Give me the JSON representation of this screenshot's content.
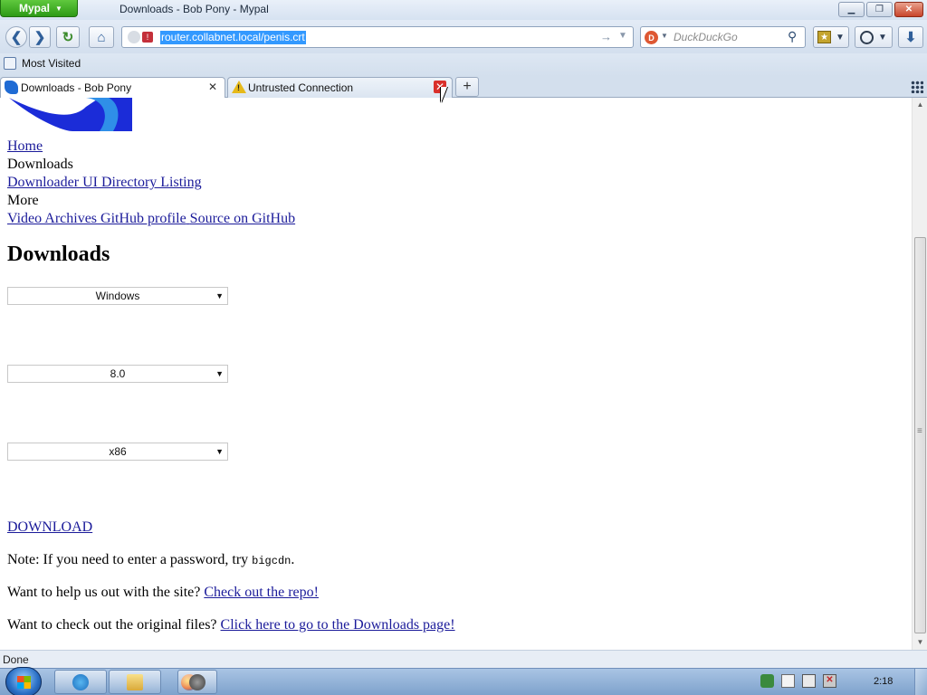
{
  "browser": {
    "app_menu_label": "Mypal",
    "window_title": "Downloads - Bob Pony - Mypal",
    "url": "router.collabnet.local/penis.crt",
    "search_placeholder": "DuckDuckGo",
    "search_engine_letter": "D"
  },
  "bookmarks_toolbar": {
    "most_visited": "Most Visited"
  },
  "tabs": [
    {
      "title": "Downloads - Bob Pony",
      "active": true
    },
    {
      "title": "Untrusted Connection",
      "active": false
    }
  ],
  "page": {
    "nav": {
      "home": "Home",
      "downloads": "Downloads",
      "downloader_ui": "Downloader UI Directory Listing",
      "more": "More",
      "more_links": [
        "Video Archives",
        "GitHub profile",
        "Source on GitHub"
      ]
    },
    "heading": "Downloads",
    "selects": {
      "os": "Windows",
      "version": "8.0",
      "arch": "x86"
    },
    "download_link": "DOWNLOAD",
    "note_password": {
      "text": "Note: If you need to enter a password, try ",
      "code": "bigcdn",
      "suffix": "."
    },
    "note_repo": {
      "text": "Want to help us out with the site? ",
      "link": "Check out the repo!"
    },
    "note_original": {
      "text": "Want to check out the original files? ",
      "link": "Click here to go to the Downloads page!"
    }
  },
  "status_bar": {
    "text": "Done"
  },
  "taskbar": {
    "clock": "2:18"
  },
  "colors": {
    "link": "#1b1b9a",
    "url_selection": "#3399ff",
    "app_menu": "#3fae24",
    "tab_close_hover": "#d9302b"
  }
}
